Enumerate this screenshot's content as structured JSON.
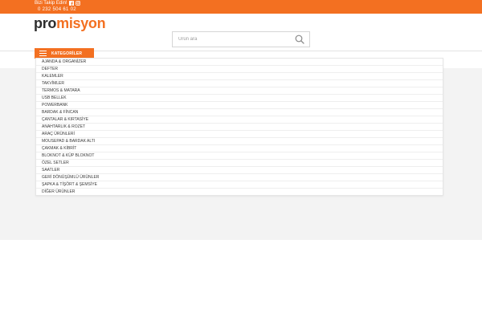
{
  "topbar": {
    "follow_label": "Bizi Takip Edin!",
    "facebook_icon": "facebook-icon",
    "instagram_icon": "instagram-icon",
    "phone": "0 232 504 61 02",
    "color": "#f37021"
  },
  "header": {
    "logo_part1": "pro",
    "logo_part2": "misyon"
  },
  "search": {
    "placeholder": "Ürün ara",
    "icon": "search-icon"
  },
  "categories": {
    "button_label": "KATEGORİLER",
    "icon": "hamburger-icon",
    "items": [
      "AJANDA & ORGANİZER",
      "DEFTER",
      "KALEMLER",
      "TAKVİMLER",
      "TERMOS & MATARA",
      "USB BELLEK",
      "POWERBANK",
      "BARDAK & FİNCAN",
      "ÇANTALAR & KIRTASİYE",
      "ANAHTARLIK & ROZET",
      "ARAÇ ÜRÜNLERİ",
      "MOUSEPAD & BARDAK ALTI",
      "ÇAKMAK & KİBRİT",
      "BLOKNOT & KÜP BLOKNOT",
      "ÖZEL SETLER",
      "SAATLER",
      "GERİ DÖNÜŞÜMLÜ ÜRÜNLER",
      "ŞAPKA & TİŞÖRT & ŞEMSİYE",
      "DİĞER ÜRÜNLER"
    ]
  }
}
